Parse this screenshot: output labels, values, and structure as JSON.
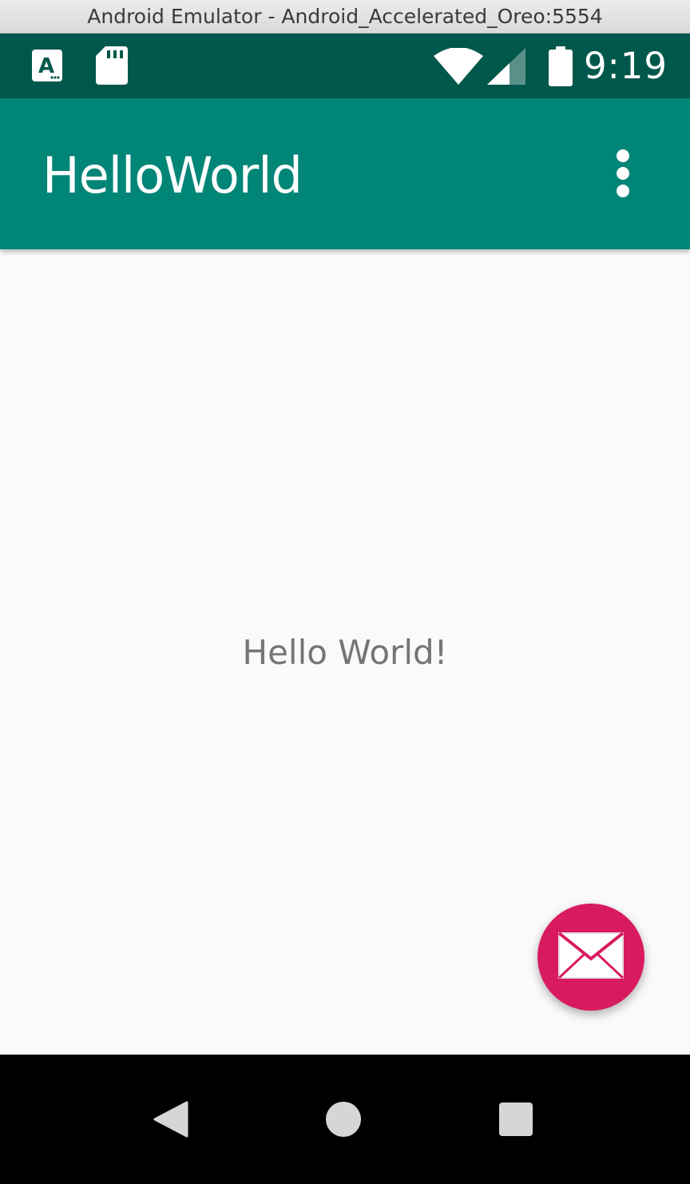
{
  "window": {
    "title": "Android Emulator - Android_Accelerated_Oreo:5554"
  },
  "status_bar": {
    "time": "9:19",
    "left_icons": [
      "accessibility-a-icon",
      "sd-card-icon"
    ],
    "right_icons": [
      "wifi-icon",
      "cell-signal-icon",
      "battery-icon"
    ],
    "background": "#00574b"
  },
  "app_bar": {
    "title": "HelloWorld",
    "background": "#008577",
    "overflow_icon": "more-vert-icon"
  },
  "main": {
    "text": "Hello World!"
  },
  "fab": {
    "icon": "email-icon",
    "color": "#d81b60"
  },
  "nav_bar": {
    "buttons": [
      "back-icon",
      "home-icon",
      "recents-icon"
    ]
  }
}
